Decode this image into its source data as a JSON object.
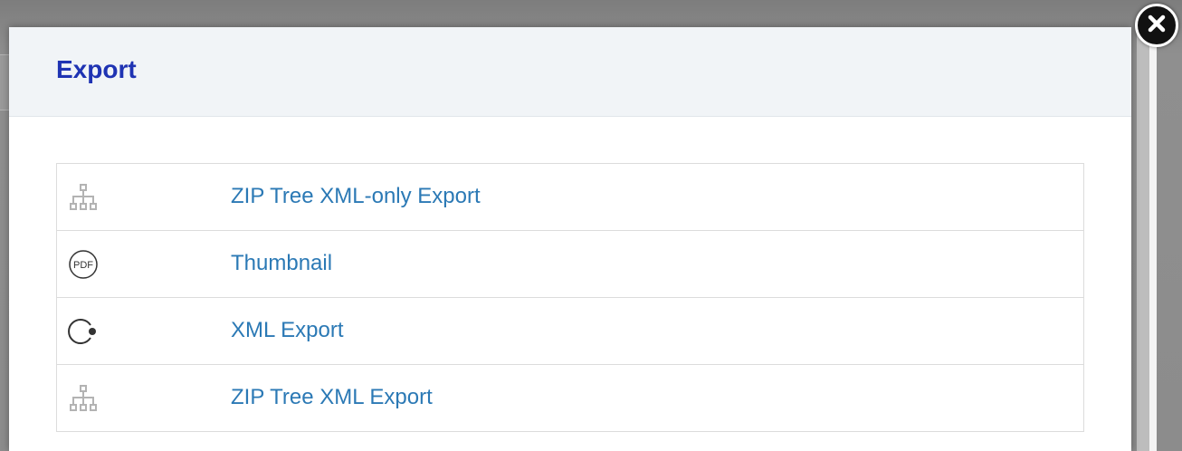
{
  "modal": {
    "title": "Export"
  },
  "close_button": {
    "icon": "close-icon"
  },
  "export_options": [
    {
      "label": "ZIP Tree XML-only Export",
      "icon": "sitemap-icon"
    },
    {
      "label": "Thumbnail",
      "icon": "pdf-icon",
      "icon_text": "PDF"
    },
    {
      "label": "XML Export",
      "icon": "circle-dot-icon"
    },
    {
      "label": "ZIP Tree XML Export",
      "icon": "sitemap-icon"
    }
  ],
  "colors": {
    "title": "#1f33b3",
    "link": "#2b79b5",
    "header_bg": "#f1f4f7",
    "border": "#dcdcdc"
  }
}
